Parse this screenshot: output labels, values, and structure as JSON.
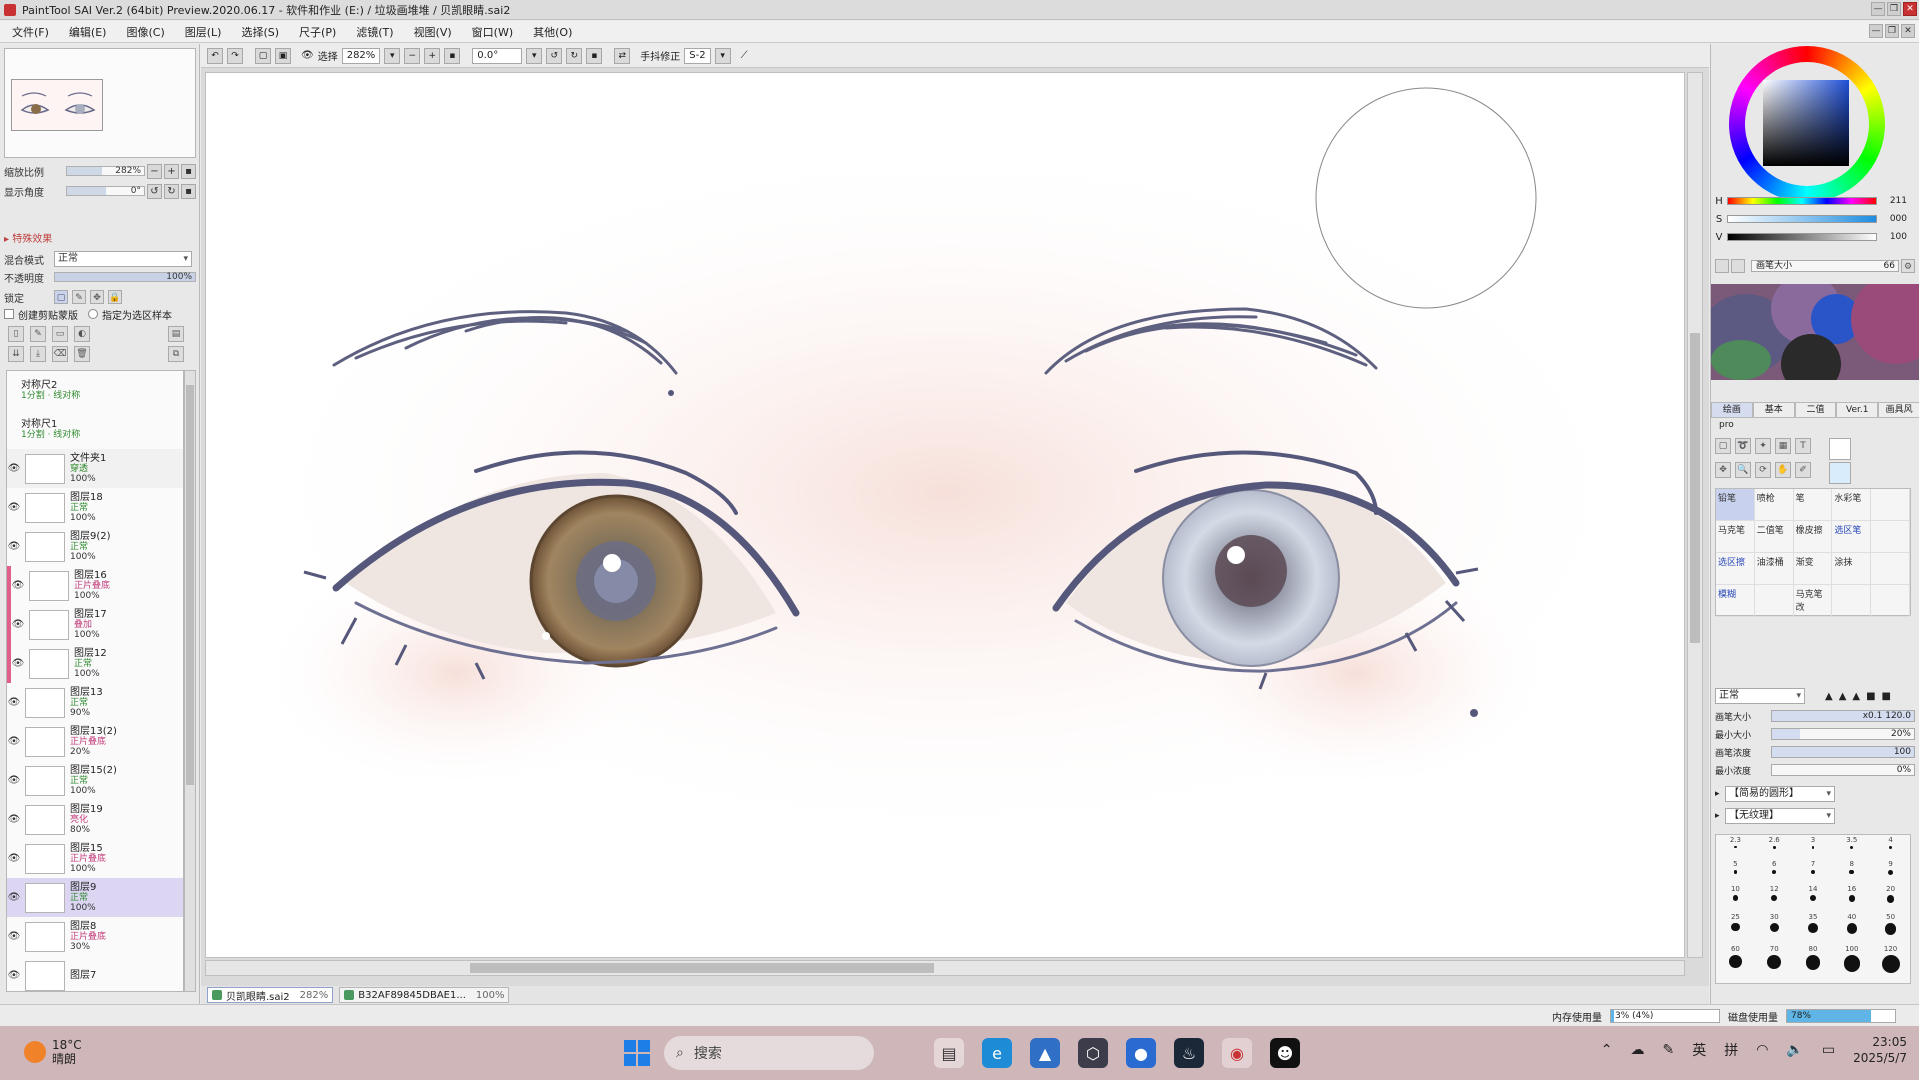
{
  "window": {
    "title": "PaintTool SAI Ver.2 (64bit) Preview.2020.06.17 - 软件和作业 (E:) / 垃圾画堆堆 / 贝凯眼睛.sai2",
    "controls": [
      "—",
      "❐",
      "✕"
    ]
  },
  "menu": [
    "文件(F)",
    "编辑(E)",
    "图像(C)",
    "图层(L)",
    "选择(S)",
    "尺子(P)",
    "滤镜(T)",
    "视图(V)",
    "窗口(W)",
    "其他(O)"
  ],
  "navigator": {
    "zoom_label": "缩放比例",
    "zoom_value": "282%",
    "zoom_fraction": 0.45,
    "angle_label": "显示角度",
    "angle_value": "0°",
    "angle_fraction": 0.5
  },
  "layer_props": {
    "effects_label": "▸ 特殊效果",
    "blend_label": "混合模式",
    "blend_value": "正常",
    "opacity_label": "不透明度",
    "opacity_value": "100%",
    "lock_label": "锁定",
    "clip_label": "创建剪贴蒙版",
    "ref_label": "指定为选区样本"
  },
  "layers": [
    {
      "name": "对称尺2",
      "mode": "1分割 · 线对称",
      "opacity": "",
      "type": "ruler"
    },
    {
      "name": "对称尺1",
      "mode": "1分割 · 线对称",
      "opacity": "",
      "type": "ruler"
    },
    {
      "name": "文件夹1",
      "mode": "穿透",
      "opacity": "100%",
      "type": "folder"
    },
    {
      "name": "图层18",
      "mode": "正常",
      "opacity": "100%",
      "type": "layer"
    },
    {
      "name": "图层9(2)",
      "mode": "正常",
      "opacity": "100%",
      "type": "layer"
    },
    {
      "name": "图层16",
      "mode": "正片叠底",
      "opacity": "100%",
      "type": "clipped"
    },
    {
      "name": "图层17",
      "mode": "叠加",
      "opacity": "100%",
      "type": "clipped"
    },
    {
      "name": "图层12",
      "mode": "正常",
      "opacity": "100%",
      "type": "clipped"
    },
    {
      "name": "图层13",
      "mode": "正常",
      "opacity": "90%",
      "type": "layer"
    },
    {
      "name": "图层13(2)",
      "mode": "正片叠底",
      "opacity": "20%",
      "type": "layer"
    },
    {
      "name": "图层15(2)",
      "mode": "正常",
      "opacity": "100%",
      "type": "layer"
    },
    {
      "name": "图层19",
      "mode": "亮化",
      "opacity": "80%",
      "type": "layer"
    },
    {
      "name": "图层15",
      "mode": "正片叠底",
      "opacity": "100%",
      "type": "layer"
    },
    {
      "name": "图层9",
      "mode": "正常",
      "opacity": "100%",
      "type": "selected"
    },
    {
      "name": "图层8",
      "mode": "正片叠底",
      "opacity": "30%",
      "type": "layer"
    },
    {
      "name": "图层7",
      "mode": "",
      "opacity": "",
      "type": "layer"
    }
  ],
  "canvas_toolbar": {
    "select_label": "选择",
    "zoom": "282%",
    "angle": "0.0°",
    "stabilizer_label": "手抖修正",
    "stabilizer_value": "S-2"
  },
  "doc_tabs": [
    {
      "name": "贝凯眼睛.sai2",
      "zoom": "282%",
      "active": true
    },
    {
      "name": "B32AF89845DBAE1...",
      "zoom": "100%",
      "active": false
    }
  ],
  "color": {
    "h_label": "H",
    "h_value": "211",
    "s_label": "S",
    "s_value": "000",
    "v_label": "V",
    "v_value": "100",
    "brush_size_label": "画笔大小",
    "brush_size_value": "66"
  },
  "tool_tabs": [
    "绘画",
    "基本",
    "二值",
    "Ver.1",
    "画具风",
    "pro"
  ],
  "tools": [
    {
      "label": "铅笔",
      "blue": false,
      "sel": true
    },
    {
      "label": "喷枪",
      "blue": false,
      "sel": false
    },
    {
      "label": "笔",
      "blue": false,
      "sel": false
    },
    {
      "label": "水彩笔",
      "blue": false,
      "sel": false
    },
    {
      "label": "",
      "blue": false,
      "sel": false
    },
    {
      "label": "马克笔",
      "blue": false,
      "sel": false
    },
    {
      "label": "二值笔",
      "blue": false,
      "sel": false
    },
    {
      "label": "橡皮擦",
      "blue": false,
      "sel": false
    },
    {
      "label": "选区笔",
      "blue": true,
      "sel": false
    },
    {
      "label": "",
      "blue": false,
      "sel": false
    },
    {
      "label": "选区擦",
      "blue": true,
      "sel": false
    },
    {
      "label": "油漆桶",
      "blue": false,
      "sel": false
    },
    {
      "label": "渐变",
      "blue": false,
      "sel": false
    },
    {
      "label": "涂抹",
      "blue": false,
      "sel": false
    },
    {
      "label": "",
      "blue": false,
      "sel": false
    },
    {
      "label": "模糊",
      "blue": true,
      "sel": false
    },
    {
      "label": "",
      "blue": false,
      "sel": false
    },
    {
      "label": "马克笔改",
      "blue": false,
      "sel": false
    },
    {
      "label": "",
      "blue": false,
      "sel": false
    },
    {
      "label": "",
      "blue": false,
      "sel": false
    }
  ],
  "brush": {
    "mode_value": "正常",
    "size_label": "画笔大小",
    "size_value": "x0.1  120.0",
    "min_size_label": "最小大小",
    "min_size_value": "20%",
    "density_label": "画笔浓度",
    "density_value": "100",
    "min_density_label": "最小浓度",
    "min_density_value": "0%",
    "shape_value": "【简易的圆形】",
    "texture_value": "【无纹理】"
  },
  "brush_sizes": [
    "2.3",
    "2.6",
    "3",
    "3.5",
    "4",
    "5",
    "6",
    "7",
    "8",
    "9",
    "10",
    "12",
    "14",
    "16",
    "20",
    "25",
    "30",
    "35",
    "40",
    "50",
    "60",
    "70",
    "80",
    "100",
    "120"
  ],
  "status": {
    "mem_label": "内存使用量",
    "mem_value": "3% (4%)",
    "mem_fraction": 0.03,
    "disk_label": "磁盘使用量",
    "disk_value": "78%",
    "disk_fraction": 0.78
  },
  "taskbar": {
    "temperature": "18°C",
    "weather": "晴朗",
    "search_placeholder": "搜索",
    "ime1": "英",
    "ime2": "拼",
    "time": "23:05",
    "date": "2025/5/7"
  }
}
